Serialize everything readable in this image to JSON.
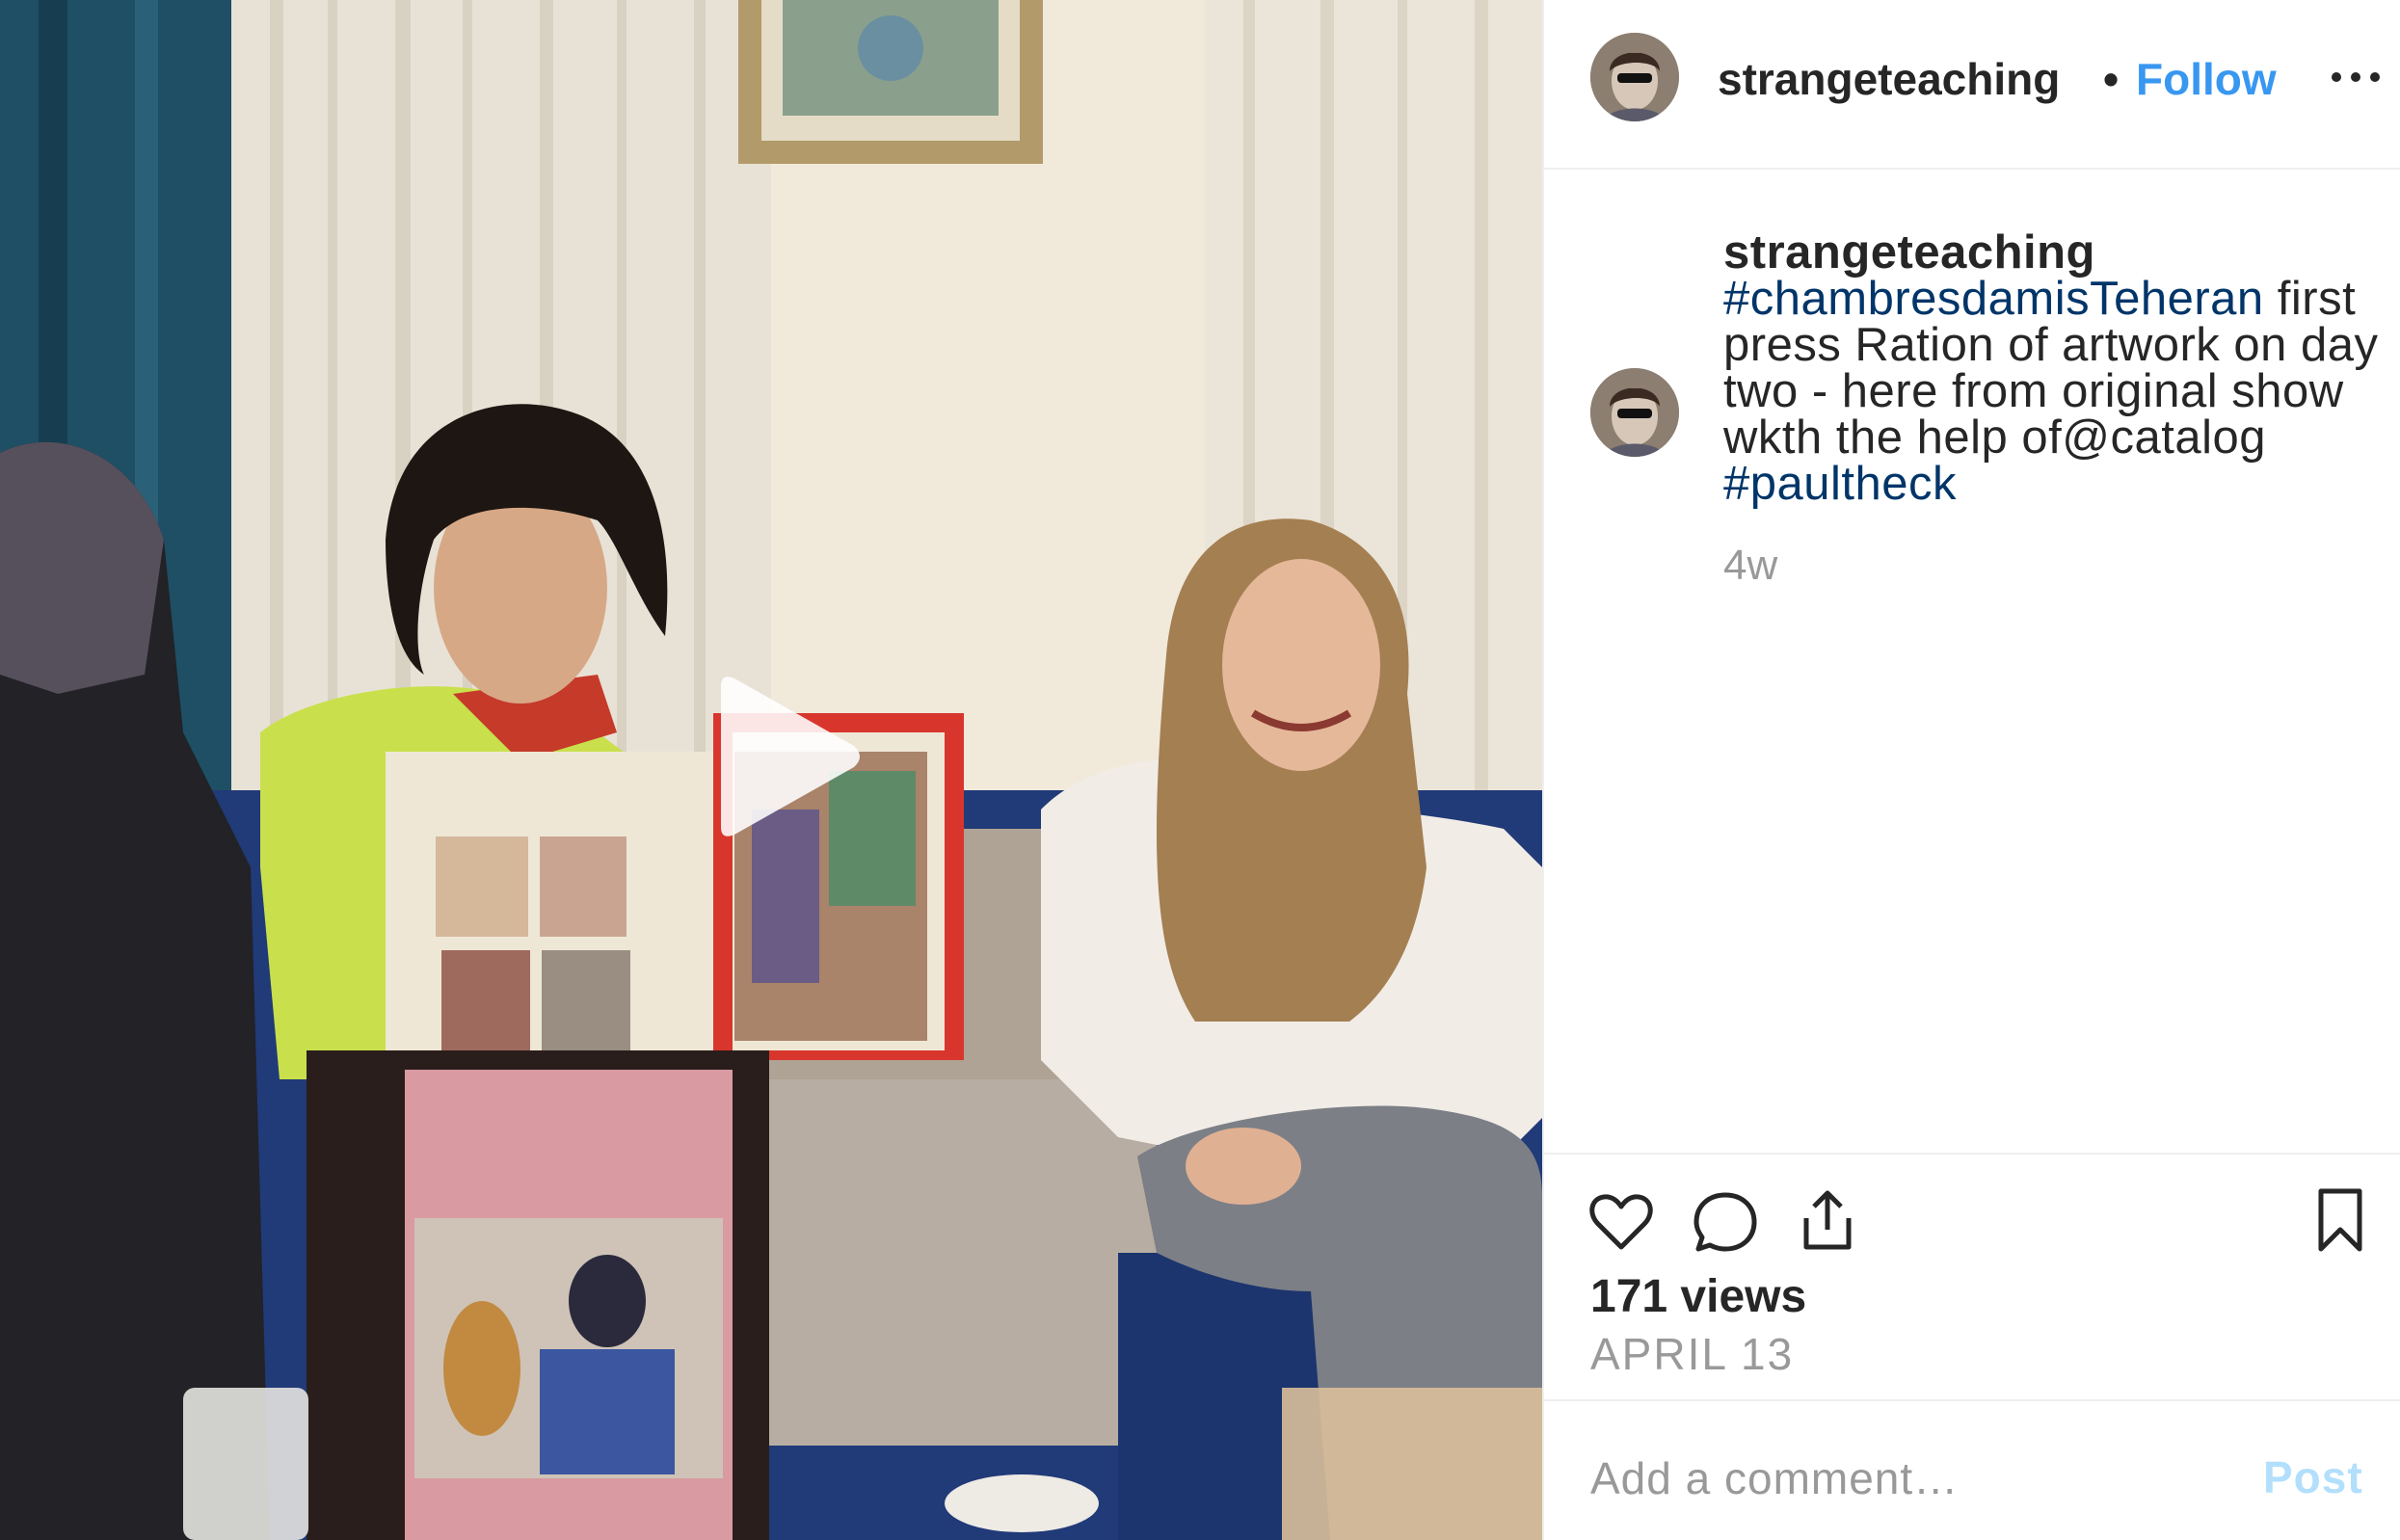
{
  "header": {
    "username": "strangeteaching",
    "separator": "•",
    "follow_label": "Follow",
    "more_icon": "more-horizontal-icon"
  },
  "caption": {
    "username": "strangeteaching",
    "hashtag_1": "#chambresdamisTeheran",
    "text": " first press Ration of artwork on day two - here from original show wkth the help of@catalog ",
    "hashtag_2": "#paultheck",
    "time": "4w"
  },
  "actions": {
    "like_icon": "heart-icon",
    "comment_icon": "comment-icon",
    "share_icon": "share-icon",
    "save_icon": "bookmark-icon",
    "views": "171 views",
    "date": "APRIL 13"
  },
  "comment": {
    "placeholder": "Add a comment…",
    "post_label": "Post"
  },
  "media": {
    "play_icon": "play-icon"
  },
  "colors": {
    "accent": "#3897f0",
    "hashtag": "#003569",
    "muted": "#999999",
    "post_disabled": "#b2dffc",
    "border": "#efefef"
  }
}
